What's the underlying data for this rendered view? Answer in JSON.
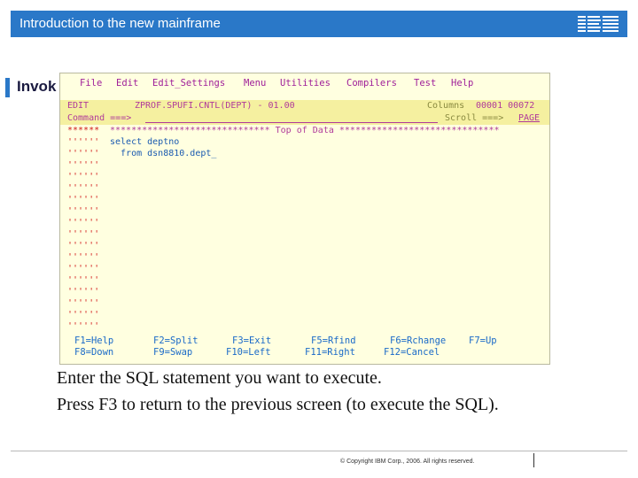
{
  "header": {
    "title": "Introduction to the new mainframe",
    "logo_text": "IBM",
    "bar_color": "#2a78c8"
  },
  "slide": {
    "title": "Invok"
  },
  "terminal": {
    "menu": [
      "File",
      "Edit",
      "Edit_Settings",
      "Menu",
      "Utilities",
      "Compilers",
      "Test",
      "Help"
    ],
    "edit_label": "EDIT",
    "dataset": "ZPROF.SPUFI.CNTL(DEPT) - 01.00",
    "columns_label": "Columns",
    "columns_value": "00001 00072",
    "command_label": "Command ===>",
    "command_value": "",
    "scroll_label": "Scroll ===>",
    "scroll_value": "PAGE",
    "top_marker": "******",
    "top_of_data": "****************************** Top of Data ******************************",
    "code_lines": [
      "select deptno",
      "  from dsn8810.dept_"
    ],
    "blank_line_marker": "''''''",
    "function_keys": [
      [
        "F1=Help",
        "F2=Split",
        "F3=Exit",
        "F5=Rfind",
        "F6=Rchange",
        "F7=Up"
      ],
      [
        "F8=Down",
        "F9=Swap",
        "F10=Left",
        "F11=Right",
        "F12=Cancel"
      ]
    ]
  },
  "instructions": [
    "Enter the SQL statement you want to execute.",
    "Press F3 to return to the previous screen (to execute the SQL)."
  ],
  "footer": {
    "copyright": "© Copyright IBM Corp., 2006. All rights reserved."
  }
}
